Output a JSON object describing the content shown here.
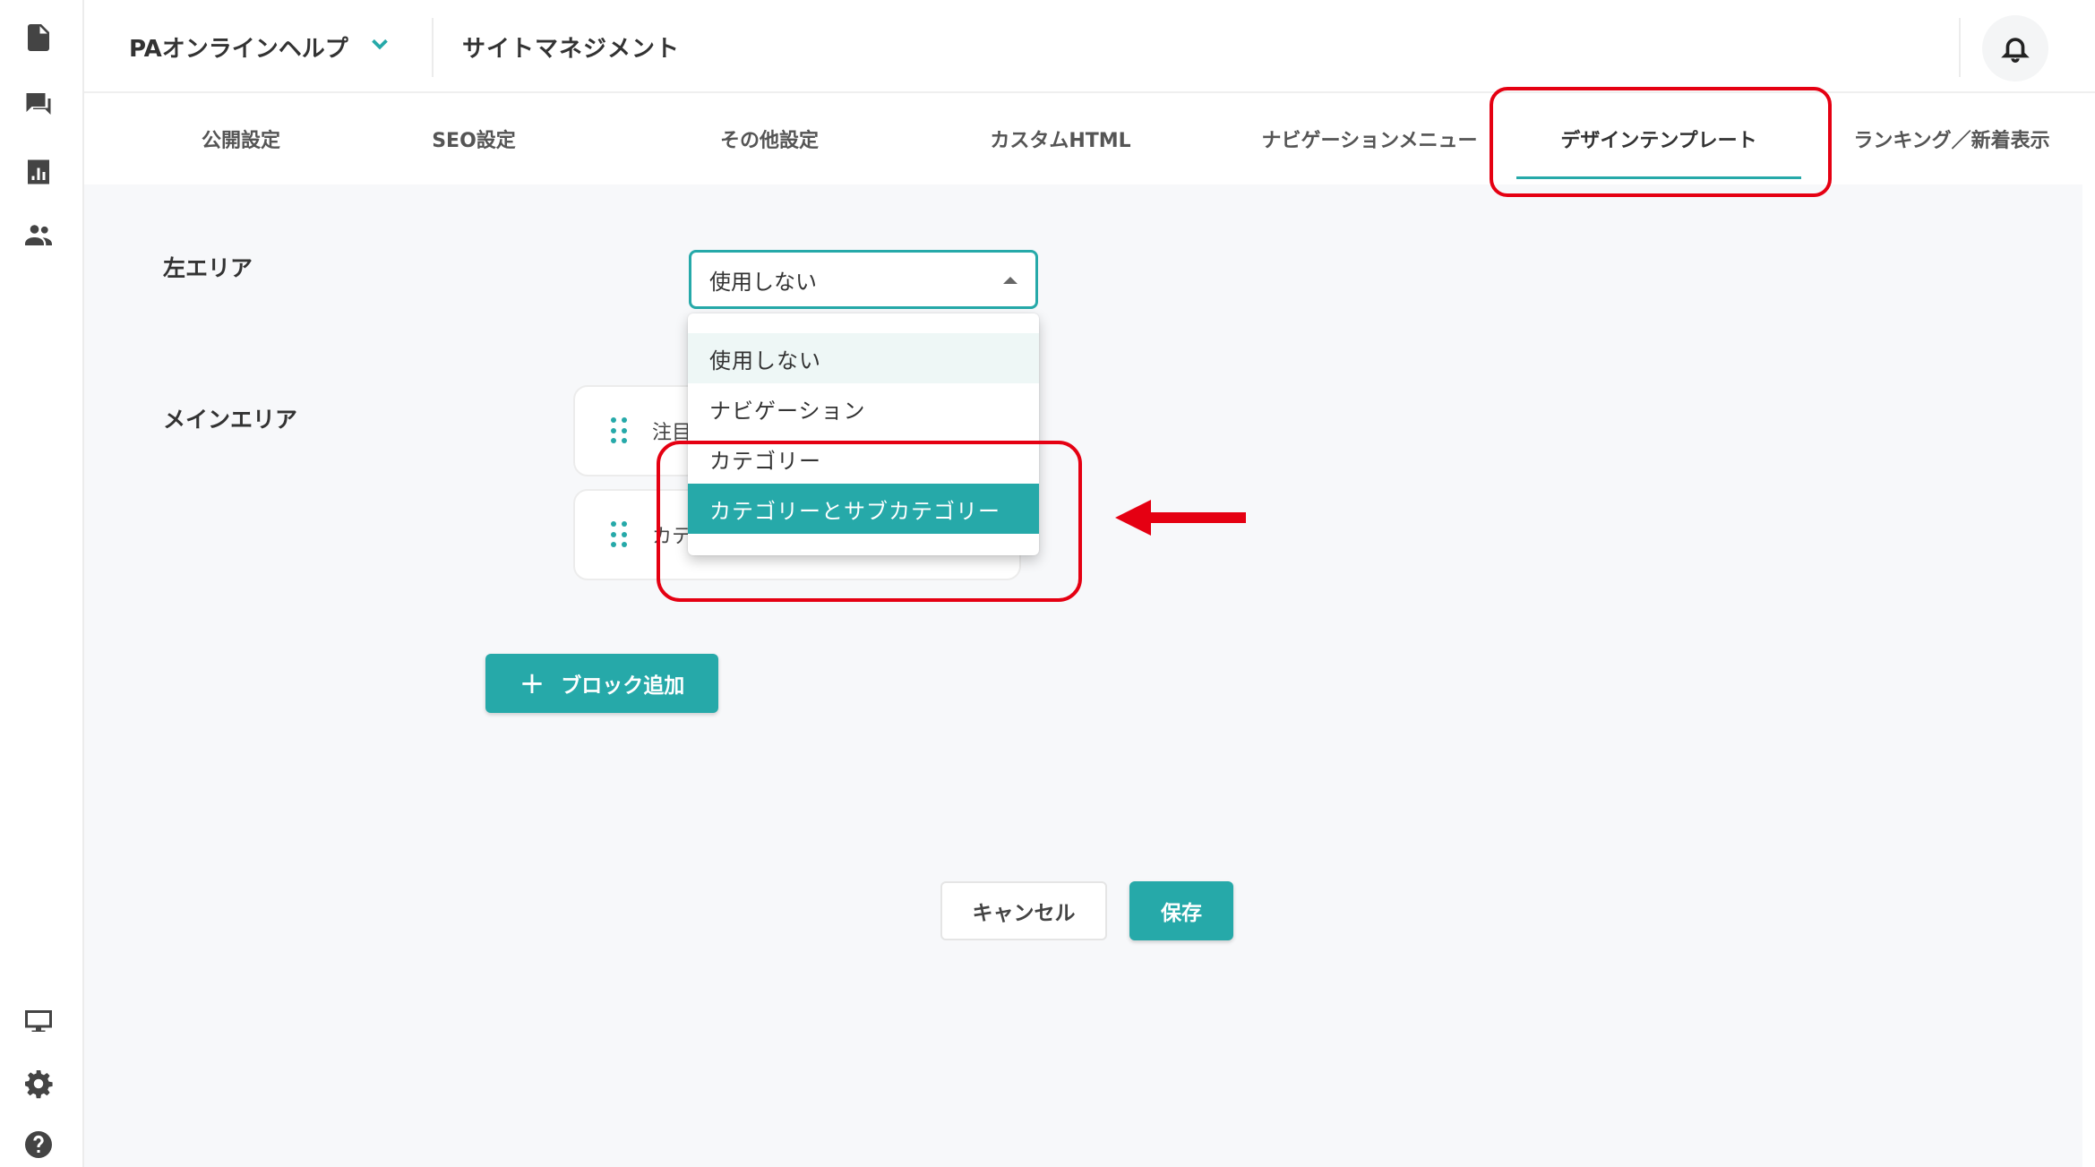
{
  "header": {
    "site_name": "PAオンラインヘルプ",
    "title": "サイトマネジメント"
  },
  "tabs": [
    {
      "label": "公開設定",
      "active": false
    },
    {
      "label": "SEO設定",
      "active": false
    },
    {
      "label": "その他設定",
      "active": false
    },
    {
      "label": "カスタムHTML",
      "active": false
    },
    {
      "label": "ナビゲーションメニュー",
      "active": false
    },
    {
      "label": "デザインテンプレート",
      "active": true
    },
    {
      "label": "ランキング／新着表示",
      "active": false
    }
  ],
  "form": {
    "left_area_label": "左エリア",
    "left_area_value": "使用しない",
    "main_area_label": "メインエリア",
    "blocks": [
      {
        "label": "注目"
      },
      {
        "label": "カテ"
      }
    ],
    "add_block_label": "ブロック追加",
    "cancel_label": "キャンセル",
    "save_label": "保存"
  },
  "dropdown": {
    "options": [
      {
        "label": "使用しない",
        "state": "selected"
      },
      {
        "label": "ナビゲーション",
        "state": "normal"
      },
      {
        "label": "カテゴリー",
        "state": "normal"
      },
      {
        "label": "カテゴリーとサブカテゴリー",
        "state": "hover"
      }
    ]
  },
  "colors": {
    "accent": "#26a9a9",
    "annotation": "#e50012"
  },
  "icons": {
    "rail_top": [
      "document-icon",
      "chat-icon",
      "bar-chart-icon",
      "people-icon"
    ],
    "rail_bottom": [
      "monitor-icon",
      "gear-icon",
      "help-icon"
    ],
    "header": [
      "chevron-down-icon",
      "bell-icon"
    ]
  }
}
